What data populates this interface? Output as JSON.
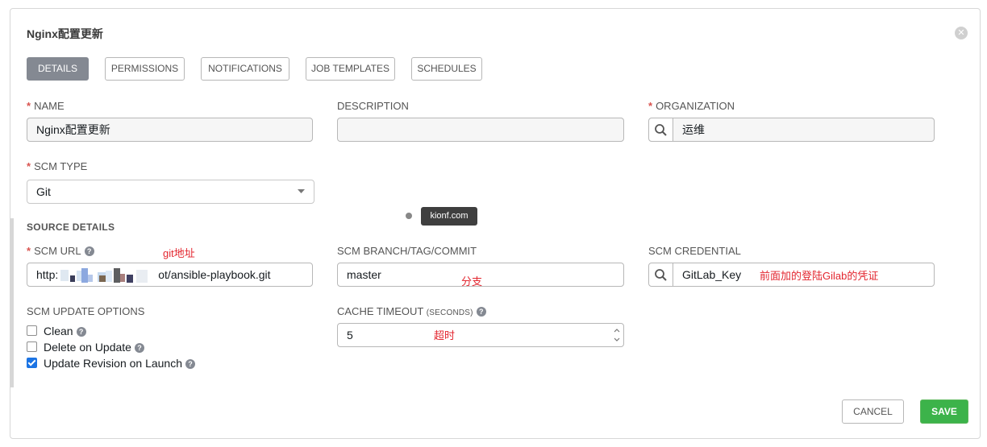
{
  "title": "Nginx配置更新",
  "tabs": [
    "DETAILS",
    "PERMISSIONS",
    "NOTIFICATIONS",
    "JOB TEMPLATES",
    "SCHEDULES"
  ],
  "fields": {
    "name": {
      "label": "NAME",
      "value": "Nginx配置更新"
    },
    "description": {
      "label": "DESCRIPTION",
      "value": ""
    },
    "organization": {
      "label": "ORGANIZATION",
      "value": "运维"
    },
    "scm_type": {
      "label": "SCM TYPE",
      "value": "Git"
    }
  },
  "source_details": {
    "title": "SOURCE DETAILS",
    "scm_url": {
      "label": "SCM URL",
      "value_prefix": "http:",
      "value_suffix": "ot/ansible-playbook.git"
    },
    "scm_branch": {
      "label": "SCM BRANCH/TAG/COMMIT",
      "value": "master"
    },
    "scm_credential": {
      "label": "SCM CREDENTIAL",
      "value": "GitLab_Key"
    },
    "update_options": {
      "label": "SCM UPDATE OPTIONS",
      "items": [
        {
          "label": "Clean",
          "checked": false
        },
        {
          "label": "Delete on Update",
          "checked": false
        },
        {
          "label": "Update Revision on Launch",
          "checked": true
        }
      ]
    },
    "cache_timeout": {
      "label": "CACHE TIMEOUT",
      "label_sub": "(SECONDS)",
      "value": "5"
    }
  },
  "annotations": {
    "git_url": "git地址",
    "branch": "分支",
    "credential": "前面加的登陆Gilab的凭证",
    "timeout": "超时"
  },
  "watermark": "kionf.com",
  "buttons": {
    "cancel": "CANCEL",
    "save": "SAVE"
  },
  "colors": {
    "save": "#3cb34a",
    "active_tab": "#848992",
    "required": "#d9534f",
    "annotation": "#e3262f"
  }
}
